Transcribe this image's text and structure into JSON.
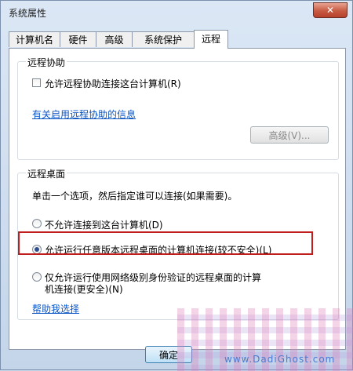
{
  "window": {
    "title": "系统属性",
    "close": "✕"
  },
  "tabs": [
    "计算机名",
    "硬件",
    "高级",
    "系统保护",
    "远程"
  ],
  "remote_assistance": {
    "title": "远程协助",
    "checkbox_label": "允许远程协助连接这台计算机(R)",
    "checked": false,
    "link": "有关启用远程协助的信息",
    "advanced_button": "高级(V)..."
  },
  "remote_desktop": {
    "title": "远程桌面",
    "description": "单击一个选项，然后指定谁可以连接(如果需要)。",
    "options": [
      {
        "label": "不允许连接到这台计算机(D)",
        "selected": false
      },
      {
        "label": "允许运行任意版本远程桌面的计算机连接(较不安全)(L)",
        "selected": true
      },
      {
        "label_line1": "仅允许运行使用网络级别身份验证的远程桌面的计算",
        "label_line2": "机连接(更安全)(N)",
        "selected": false
      }
    ],
    "help_link": "帮助我选择"
  },
  "footer": {
    "ok_button": "确定"
  },
  "watermark": {
    "text": "www.DadiGhost.com"
  }
}
